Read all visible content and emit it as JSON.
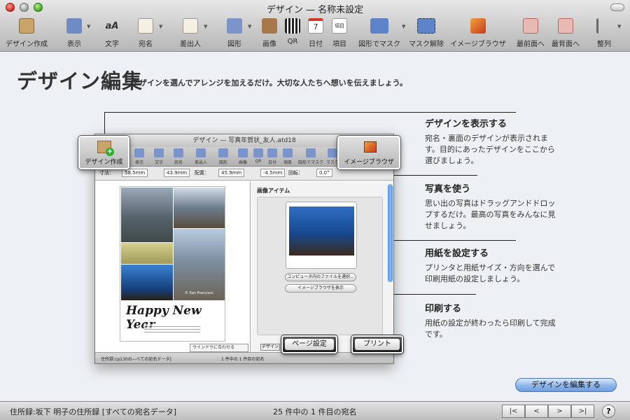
{
  "window": {
    "title": "デザイン — 名称未設定"
  },
  "toolbar": {
    "items": [
      {
        "label": "デザイン作成",
        "icon": "design-create-icon"
      },
      {
        "label": "表示",
        "icon": "view-icon"
      },
      {
        "label": "文字",
        "icon": "text-icon"
      },
      {
        "label": "宛名",
        "icon": "address-icon"
      },
      {
        "label": "差出人",
        "icon": "sender-icon"
      },
      {
        "label": "図形",
        "icon": "shape-icon"
      },
      {
        "label": "画像",
        "icon": "image-icon"
      },
      {
        "label": "QR",
        "icon": "qr-icon"
      },
      {
        "label": "日付",
        "icon": "date-icon"
      },
      {
        "label": "項目",
        "icon": "field-icon"
      },
      {
        "label": "図形でマスク",
        "icon": "shape-mask-icon"
      },
      {
        "label": "マスク解除",
        "icon": "unmask-icon"
      },
      {
        "label": "イメージブラウザ",
        "icon": "image-browser-icon"
      },
      {
        "label": "最前面へ",
        "icon": "bring-front-icon"
      },
      {
        "label": "最背面へ",
        "icon": "send-back-icon"
      },
      {
        "label": "整列",
        "icon": "align-icon"
      }
    ],
    "date_icon_text": "7",
    "field_icon_text": "項目"
  },
  "heading": {
    "title": "デザイン編集",
    "subtitle": "デザインを選んでアレンジを加えるだけ。大切な人たちへ想いを伝えましょう。"
  },
  "mini": {
    "title": "デザイン — 写真年賀状_友人.atd18",
    "toolbar": [
      "表示",
      "文字",
      "宛名",
      "差出人",
      "図形",
      "画像",
      "QR",
      "日付",
      "項目",
      "図形でマスク",
      "マスク"
    ],
    "measure": {
      "label": "寸法：",
      "w": "58.5mm",
      "h": "43.9mm",
      "pos_label": "配置：",
      "x": "45.9mm",
      "y": "-4.5mm",
      "rot_label": "回転：",
      "rot": "0.0°"
    },
    "panel_title": "画像アイテム",
    "btn_file": "コンピュータ内のファイルを選択...",
    "btn_browser": "イメージブラウザを表示",
    "greeting": "Happy New Year",
    "photo_caption": "© San Francisco",
    "fit": "ウインドウに合わせる",
    "status_left": "住所録:cp130の―べての宛名データ]",
    "status_mid": "1 件中の 1 件目の宛名",
    "design_tab": "デザイン"
  },
  "callouts": {
    "design_create": "デザイン作成",
    "image_browser": "イメージブラウザ",
    "page_setup": "ページ設定",
    "print": "プリント"
  },
  "explanations": [
    {
      "title": "デザインを表示する",
      "body": "宛名・裏面のデザインが表示されます。目的にあったデザインをここから選びましょう。"
    },
    {
      "title": "写真を使う",
      "body": "思い出の写真はドラッグアンドドロップするだけ。最高の写真をみんなに見せましょう。"
    },
    {
      "title": "用紙を設定する",
      "body": "プリンタと用紙サイズ・方向を選んで印刷用紙の設定しましょう。"
    },
    {
      "title": "印刷する",
      "body": "用紙の設定が終わったら印刷して完成です。"
    }
  ],
  "edit_button": "デザインを編集する",
  "status": {
    "address_book": "住所録:坂下 明子の住所録 [すべての宛名データ]",
    "count": "25 件中の 1 件目の宛名",
    "nav": [
      "|<",
      "<",
      ">",
      ">|"
    ],
    "help": "?"
  },
  "colors": {
    "accent": "#6e9ee0",
    "window_bg": "#edf0f4"
  }
}
